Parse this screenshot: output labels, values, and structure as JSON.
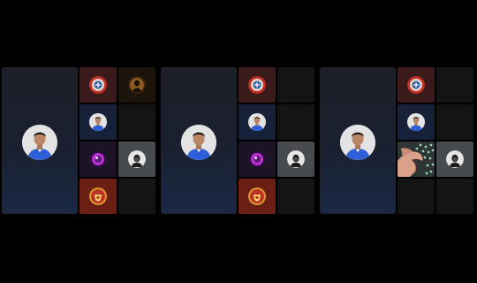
{
  "panels": [
    {
      "main_avatar_icon": "player-avatar-icon",
      "grid": [
        [
          "club-crest-icon",
          "dark-avatar-icon"
        ],
        [
          "player-avatar-icon",
          "empty"
        ],
        [
          "purple-glow-icon",
          "hooded-avatar-icon"
        ],
        [
          "manchester-united-crest-icon",
          "empty"
        ]
      ]
    },
    {
      "main_avatar_icon": "player-avatar-icon",
      "grid": [
        [
          "club-crest-icon",
          "empty"
        ],
        [
          "player-avatar-icon",
          "empty"
        ],
        [
          "purple-glow-icon",
          "hooded-avatar-icon"
        ],
        [
          "manchester-united-crest-icon",
          "empty"
        ]
      ]
    },
    {
      "main_avatar_icon": "player-avatar-icon",
      "grid": [
        [
          "club-crest-icon",
          "empty"
        ],
        [
          "player-avatar-icon",
          "empty"
        ],
        [
          "hand-photo",
          "hooded-avatar-icon"
        ],
        [
          "empty",
          "empty"
        ]
      ]
    }
  ],
  "colors": {
    "background": "#000000",
    "main_tile_top": "#1c1f27",
    "main_tile_bottom": "#1a2844",
    "jersey_blue": "#2f5fd6",
    "crest_red": "#c0312a",
    "crest_gold": "#d8a02b"
  }
}
